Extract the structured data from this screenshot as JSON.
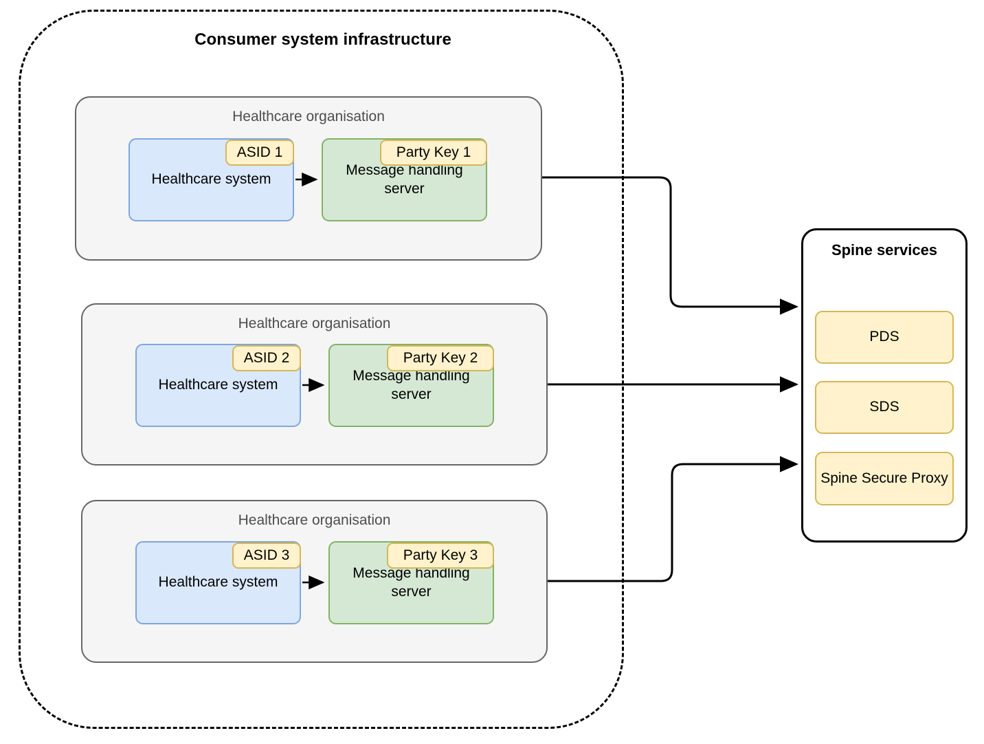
{
  "diagram": {
    "title": "Consumer system infrastructure",
    "boundary_name": "consumer-system-infrastructure"
  },
  "organisations": [
    {
      "group_label": "Healthcare organisation",
      "system": {
        "label": "Healthcare system",
        "badge": "ASID 1"
      },
      "server": {
        "label": "Message handling server",
        "badge": "Party Key 1"
      }
    },
    {
      "group_label": "Healthcare organisation",
      "system": {
        "label": "Healthcare system",
        "badge": "ASID 2"
      },
      "server": {
        "label": "Message handling server",
        "badge": "Party Key 2"
      }
    },
    {
      "group_label": "Healthcare organisation",
      "system": {
        "label": "Healthcare system",
        "badge": "ASID 3"
      },
      "server": {
        "label": "Message handling server",
        "badge": "Party Key 3"
      }
    }
  ],
  "spine": {
    "title": "Spine services",
    "services": [
      {
        "label": "PDS"
      },
      {
        "label": "SDS"
      },
      {
        "label": "Spine Secure Proxy"
      }
    ]
  },
  "colors": {
    "system_fill": "#dae8fc",
    "system_stroke": "#7ea6e0",
    "server_fill": "#d5e8d4",
    "server_stroke": "#82b366",
    "badge_fill": "#fff2cc",
    "badge_stroke": "#d6b656",
    "group_fill": "#f5f5f5",
    "group_stroke": "#666666",
    "boundary_stroke": "#000000",
    "connector_stroke": "#000000",
    "background": "#ffffff"
  }
}
